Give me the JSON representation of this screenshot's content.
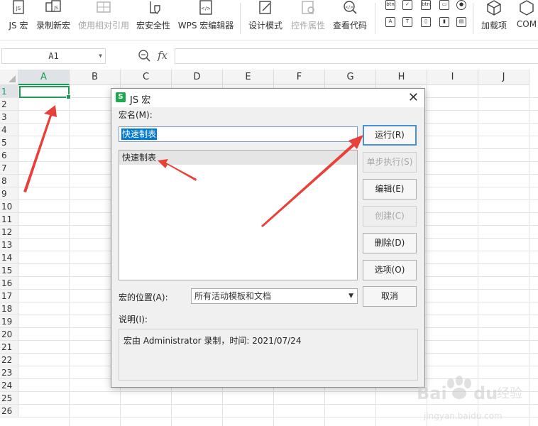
{
  "ribbon": {
    "buttons": [
      {
        "label": "JS 宏",
        "icon": "js-file-icon",
        "enabled": true
      },
      {
        "label": "录制新宏",
        "icon": "record-macro-icon",
        "enabled": true
      },
      {
        "label": "使用相对引用",
        "icon": "relative-ref-icon",
        "enabled": false
      },
      {
        "label": "宏安全性",
        "icon": "shield-icon",
        "enabled": true
      },
      {
        "label": "WPS 宏编辑器",
        "icon": "code-editor-icon",
        "enabled": true
      },
      {
        "label": "设计模式",
        "icon": "design-mode-icon",
        "enabled": true
      },
      {
        "label": "控件属性",
        "icon": "control-properties-icon",
        "enabled": false
      },
      {
        "label": "查看代码",
        "icon": "view-code-icon",
        "enabled": true
      },
      {
        "label": "加载项",
        "icon": "addins-icon",
        "enabled": true
      },
      {
        "label": "COM",
        "icon": "com-icon",
        "enabled": true
      }
    ],
    "control_icons": [
      "btn",
      "√",
      "btn",
      "▭",
      "◉",
      "A",
      "T",
      "▯",
      "▮",
      "▤"
    ]
  },
  "formula_bar": {
    "cell_ref": "A1",
    "fx_label": "fx",
    "formula_value": ""
  },
  "grid": {
    "columns": [
      "A",
      "B",
      "C",
      "D",
      "E",
      "F",
      "G",
      "H",
      "I",
      "J"
    ],
    "rows": [
      "1",
      "2",
      "3",
      "4",
      "5",
      "6",
      "7",
      "8",
      "9",
      "10",
      "11",
      "12",
      "13",
      "14",
      "15",
      "16",
      "17",
      "18",
      "19",
      "20",
      "21",
      "22",
      "23",
      "24",
      "25",
      "26"
    ],
    "selected_cell": "A1"
  },
  "dialog": {
    "title": "JS 宏",
    "macro_name_label": "宏名(M):",
    "macro_name_value": "快速制表",
    "macro_list": [
      "快速制表"
    ],
    "buttons": {
      "run": "运行(R)",
      "step": "单步执行(S)",
      "edit": "编辑(E)",
      "create": "创建(C)",
      "delete": "删除(D)",
      "options": "选项(O)",
      "cancel": "取消"
    },
    "location_label": "宏的位置(A):",
    "location_value": "所有活动模板和文档",
    "description_label": "说明(I):",
    "description_text": "宏由 Administrator 录制，时间: 2021/07/24"
  },
  "colors": {
    "accent": "#1f9b53",
    "arrow": "#e8413a",
    "selection": "#0078d7"
  }
}
